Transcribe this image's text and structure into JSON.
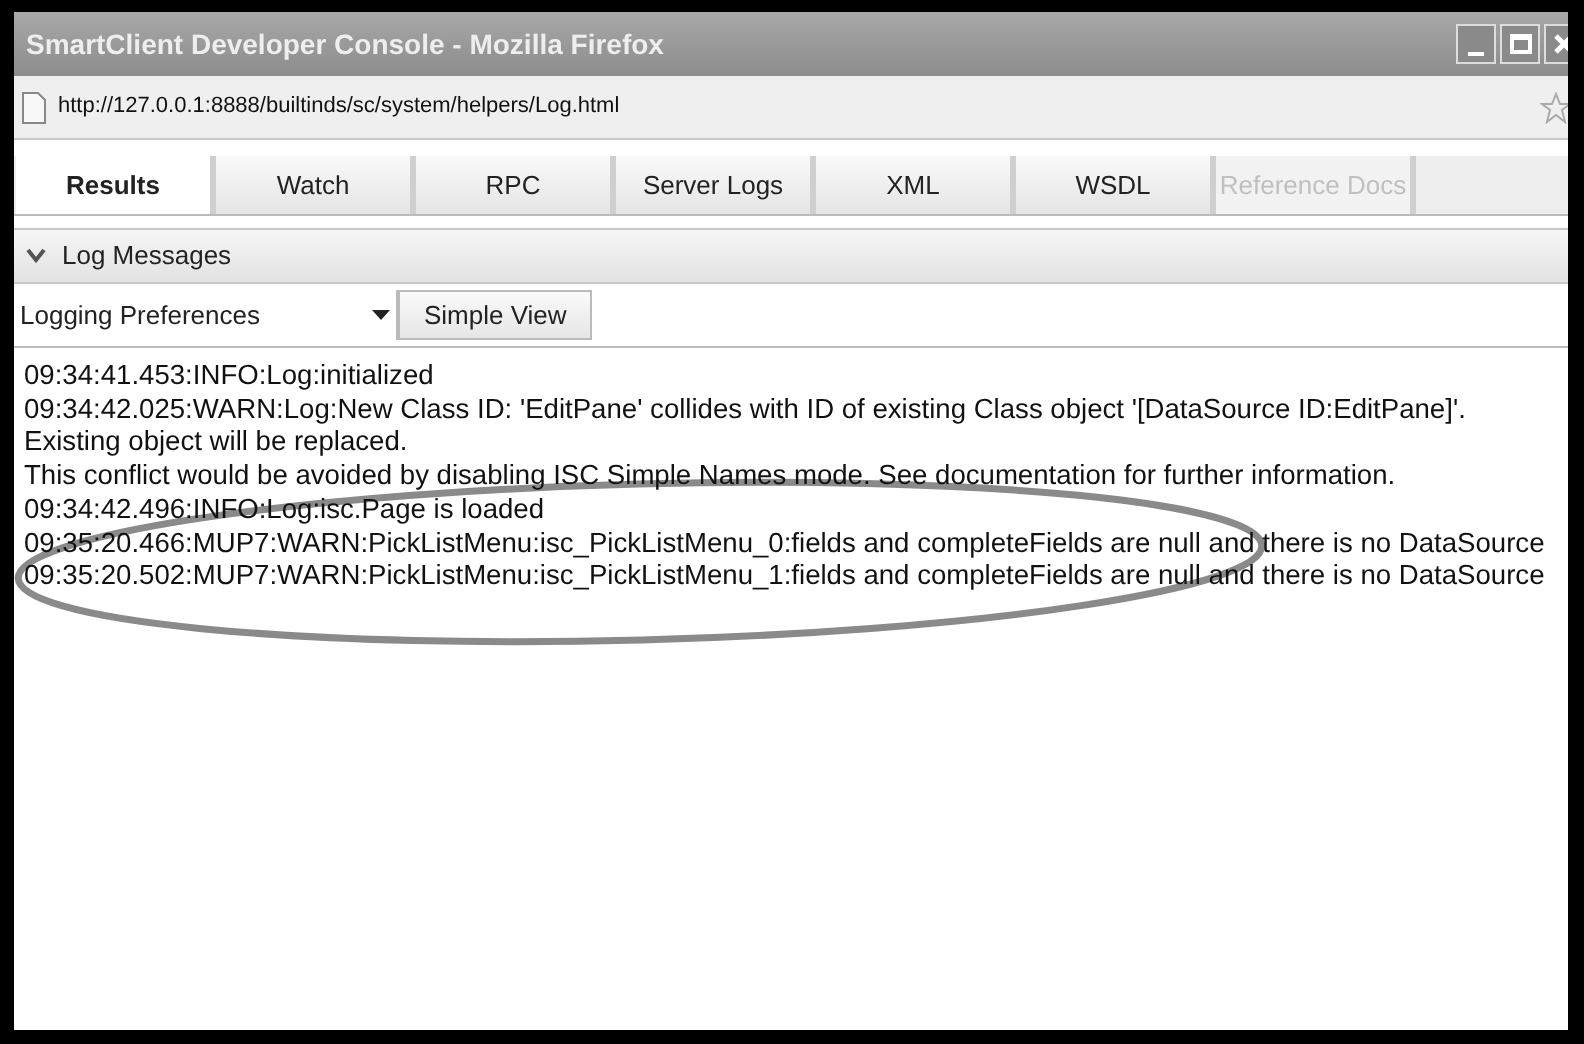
{
  "window": {
    "title": "SmartClient Developer Console - Mozilla Firefox"
  },
  "address_bar": {
    "url": "http://127.0.0.1:8888/builtinds/sc/system/helpers/Log.html"
  },
  "tabs": [
    {
      "label": "Results",
      "selected": true,
      "disabled": false
    },
    {
      "label": "Watch",
      "selected": false,
      "disabled": false
    },
    {
      "label": "RPC",
      "selected": false,
      "disabled": false
    },
    {
      "label": "Server Logs",
      "selected": false,
      "disabled": false
    },
    {
      "label": "XML",
      "selected": false,
      "disabled": false
    },
    {
      "label": "WSDL",
      "selected": false,
      "disabled": false
    },
    {
      "label": "Reference Docs",
      "selected": false,
      "disabled": true
    }
  ],
  "section": {
    "label": "Log Messages",
    "expanded": true
  },
  "toolbar": {
    "dropdown": "Logging Preferences",
    "button": "Simple View"
  },
  "log_lines": [
    "09:34:41.453:INFO:Log:initialized",
    "09:34:42.025:WARN:Log:New Class ID: 'EditPane' collides with ID of existing Class object '[DataSource ID:EditPane]'.",
    "Existing object will be replaced.",
    "This conflict would be avoided by disabling ISC Simple Names mode.  See documentation for further information.",
    "09:34:42.496:INFO:Log:isc.Page is loaded",
    "09:35:20.466:MUP7:WARN:PickListMenu:isc_PickListMenu_0:fields and completeFields are null and there is no DataSource",
    "09:35:20.502:MUP7:WARN:PickListMenu:isc_PickListMenu_1:fields and completeFields are null and there is no DataSource"
  ]
}
